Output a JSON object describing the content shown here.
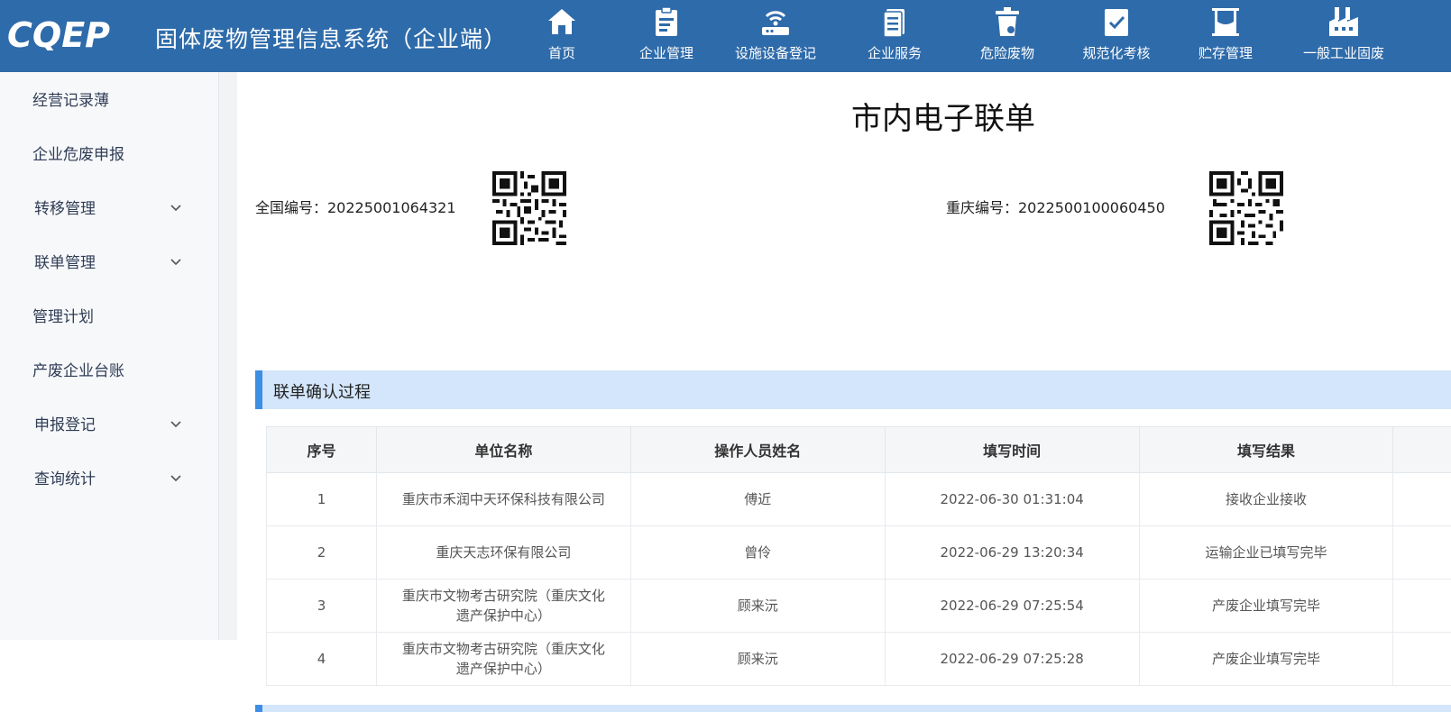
{
  "header": {
    "logo_text": "CQEP",
    "system_title": "固体废物管理信息系统（企业端）",
    "nav": [
      {
        "label": "首页",
        "icon": "home-icon"
      },
      {
        "label": "企业管理",
        "icon": "clipboard-tools-icon"
      },
      {
        "label": "设施设备登记",
        "icon": "router-icon"
      },
      {
        "label": "企业服务",
        "icon": "document-icon"
      },
      {
        "label": "危险废物",
        "icon": "trash-bin-icon"
      },
      {
        "label": "规范化考核",
        "icon": "checklist-icon"
      },
      {
        "label": "贮存管理",
        "icon": "tank-icon"
      },
      {
        "label": "一般工业固废",
        "icon": "factory-icon"
      }
    ]
  },
  "sidebar": {
    "items": [
      {
        "label": "经营记录薄",
        "expandable": false
      },
      {
        "label": "企业危废申报",
        "expandable": false
      },
      {
        "label": "转移管理",
        "expandable": true
      },
      {
        "label": "联单管理",
        "expandable": true
      },
      {
        "label": "管理计划",
        "expandable": false
      },
      {
        "label": "产废企业台账",
        "expandable": false
      },
      {
        "label": "申报登记",
        "expandable": true
      },
      {
        "label": "查询统计",
        "expandable": true
      }
    ]
  },
  "document": {
    "title": "市内电子联单",
    "national_code_label": "全国编号：20225001064321",
    "chongqing_code_label": "重庆编号：2022500100060450"
  },
  "section": {
    "title": "联单确认过程"
  },
  "table": {
    "columns": [
      "序号",
      "单位名称",
      "操作人员姓名",
      "填写时间",
      "填写结果"
    ],
    "rows": [
      {
        "no": "1",
        "unit": "重庆市禾润中天环保科技有限公司",
        "operator": "傅近",
        "time": "2022-06-30 01:31:04",
        "result": "接收企业接收"
      },
      {
        "no": "2",
        "unit": "重庆天志环保有限公司",
        "operator": "曾伶",
        "time": "2022-06-29 13:20:34",
        "result": "运输企业已填写完毕"
      },
      {
        "no": "3",
        "unit": "重庆市文物考古研究院（重庆文化遗产保护中心）",
        "operator": "顾来沅",
        "time": "2022-06-29 07:25:54",
        "result": "产废企业填写完毕"
      },
      {
        "no": "4",
        "unit": "重庆市文物考古研究院（重庆文化遗产保护中心）",
        "operator": "顾来沅",
        "time": "2022-06-29 07:25:28",
        "result": "产废企业填写完毕"
      }
    ]
  }
}
